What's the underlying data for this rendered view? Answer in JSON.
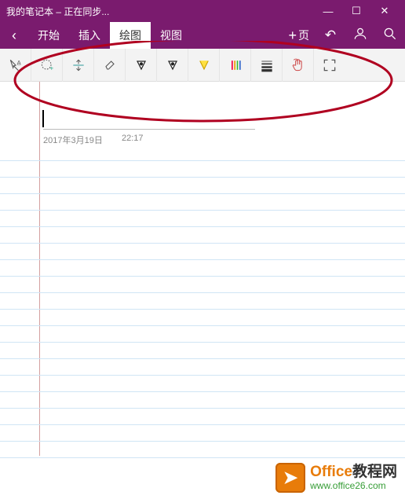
{
  "titlebar": {
    "title": "我的笔记本 – 正在同步..."
  },
  "tabs": {
    "start": "开始",
    "insert": "插入",
    "draw": "绘图",
    "view": "视图",
    "addpage": "页"
  },
  "page": {
    "date": "2017年3月19日",
    "time": "22:17"
  },
  "footer": {
    "brand1": "Office",
    "brand2": "教程网",
    "url": "www.office26.com"
  },
  "toolbar": {
    "text_tool": "文本",
    "lasso": "套索",
    "space": "空间",
    "eraser": "橡皮",
    "pen_black": "黑笔",
    "pen_black2": "黑笔2",
    "highlighter": "荧光笔",
    "colors": "颜色",
    "lines": "线条",
    "touch": "触摸",
    "fullscreen": "全屏"
  }
}
